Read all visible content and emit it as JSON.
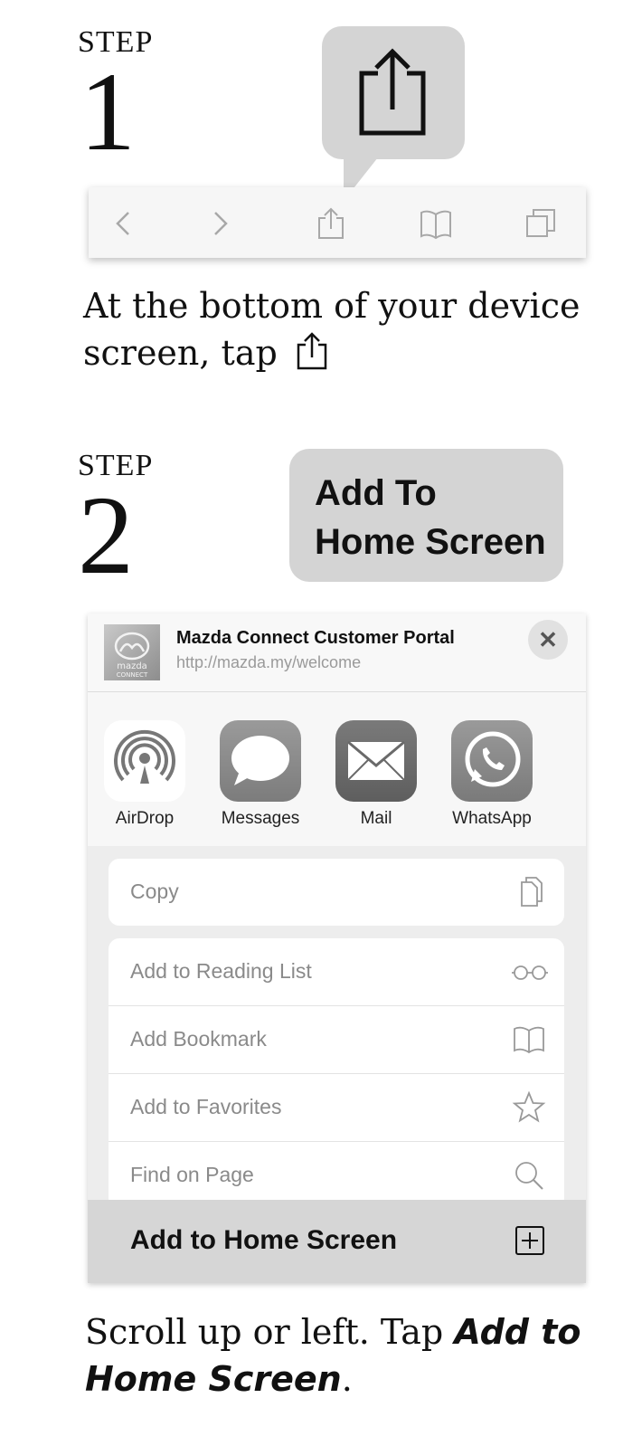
{
  "step1": {
    "word": "STEP",
    "number": "1",
    "instruction": "At the bottom of your device screen, tap"
  },
  "step2": {
    "word": "STEP",
    "number": "2",
    "bubble_line1": "Add To",
    "bubble_line2": "Home Screen"
  },
  "share_sheet": {
    "site_title": "Mazda Connect Customer Portal",
    "site_url": "http://mazda.my/welcome",
    "logo_text_top": "mazda",
    "logo_text_bottom": "CONNECT",
    "close_label": "✕",
    "apps": [
      {
        "label": "AirDrop",
        "icon": "airdrop-icon"
      },
      {
        "label": "Messages",
        "icon": "messages-icon"
      },
      {
        "label": "Mail",
        "icon": "mail-icon"
      },
      {
        "label": "WhatsApp",
        "icon": "whatsapp-icon"
      }
    ],
    "group1": [
      {
        "label": "Copy",
        "icon": "copy-icon"
      }
    ],
    "group2": [
      {
        "label": "Add to Reading List",
        "icon": "glasses-icon"
      },
      {
        "label": "Add Bookmark",
        "icon": "book-icon"
      },
      {
        "label": "Add to Favorites",
        "icon": "star-icon"
      },
      {
        "label": "Find on Page",
        "icon": "search-icon"
      }
    ],
    "home_screen_label": "Add to Home Screen"
  },
  "final_instruction": {
    "prefix": "Scroll up or left. Tap ",
    "emphasis": "Add to Home Screen",
    "suffix": "."
  }
}
